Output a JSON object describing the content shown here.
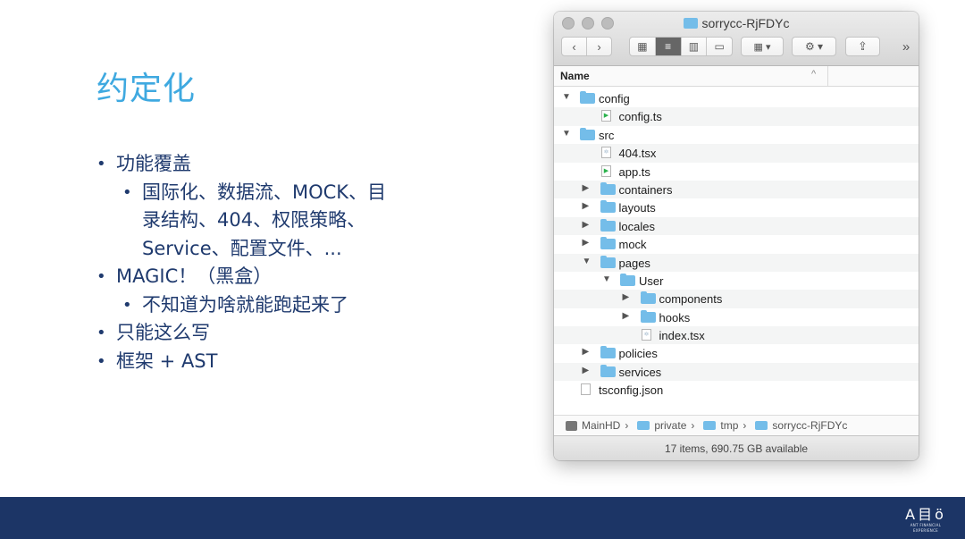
{
  "slide": {
    "title": "约定化",
    "bullets": {
      "b1": "功能覆盖",
      "b1_sub_line1": "国际化、数据流、MOCK、目",
      "b1_sub_line2": "录结构、404、权限策略、",
      "b1_sub_line3": "Service、配置文件、...",
      "b2": "MAGIC！（黑盒）",
      "b2_sub": "不知道为啥就能跑起来了",
      "b3": "只能这么写",
      "b4": "框架 + AST"
    }
  },
  "finder": {
    "window_title": "sorrycc-RjFDYc",
    "toolbar": {
      "back": "‹",
      "forward": "›",
      "view_icons": "▦",
      "view_list": "≡",
      "view_columns": "▥",
      "view_gallery": "▭",
      "group_menu": "▦ ▾",
      "action_menu": "⚙ ▾",
      "share": "⇪",
      "overflow": "»"
    },
    "column_header": {
      "name": "Name",
      "sort_indicator": "^"
    },
    "rows": [
      {
        "label": "config",
        "kind": "folder",
        "depth": 0,
        "expanded": true
      },
      {
        "label": "config.ts",
        "kind": "ts",
        "depth": 1
      },
      {
        "label": "src",
        "kind": "folder",
        "depth": 0,
        "expanded": true
      },
      {
        "label": "404.tsx",
        "kind": "tsx",
        "depth": 1
      },
      {
        "label": "app.ts",
        "kind": "ts",
        "depth": 1
      },
      {
        "label": "containers",
        "kind": "folder",
        "depth": 1,
        "expanded": false
      },
      {
        "label": "layouts",
        "kind": "folder",
        "depth": 1,
        "expanded": false
      },
      {
        "label": "locales",
        "kind": "folder",
        "depth": 1,
        "expanded": false
      },
      {
        "label": "mock",
        "kind": "folder",
        "depth": 1,
        "expanded": false
      },
      {
        "label": "pages",
        "kind": "folder",
        "depth": 1,
        "expanded": true
      },
      {
        "label": "User",
        "kind": "folder",
        "depth": 2,
        "expanded": true
      },
      {
        "label": "components",
        "kind": "folder",
        "depth": 3,
        "expanded": false
      },
      {
        "label": "hooks",
        "kind": "folder",
        "depth": 3,
        "expanded": false
      },
      {
        "label": "index.tsx",
        "kind": "tsx",
        "depth": 3
      },
      {
        "label": "policies",
        "kind": "folder",
        "depth": 1,
        "expanded": false
      },
      {
        "label": "services",
        "kind": "folder",
        "depth": 1,
        "expanded": false
      },
      {
        "label": "tsconfig.json",
        "kind": "json",
        "depth": 0
      }
    ],
    "path": [
      "MainHD",
      "private",
      "tmp",
      "sorrycc-RjFDYc"
    ],
    "path_separator": "›",
    "status": "17 items, 690.75 GB available"
  },
  "footer": {
    "logo_mark": "A目ö",
    "logo_tagline": "ANT FINANCIAL EXPERIENCE"
  },
  "colors": {
    "title": "#3fa9e0",
    "bullet_text": "#1f3a6e",
    "footer_bg": "#1c3566",
    "folder": "#74bde9"
  }
}
